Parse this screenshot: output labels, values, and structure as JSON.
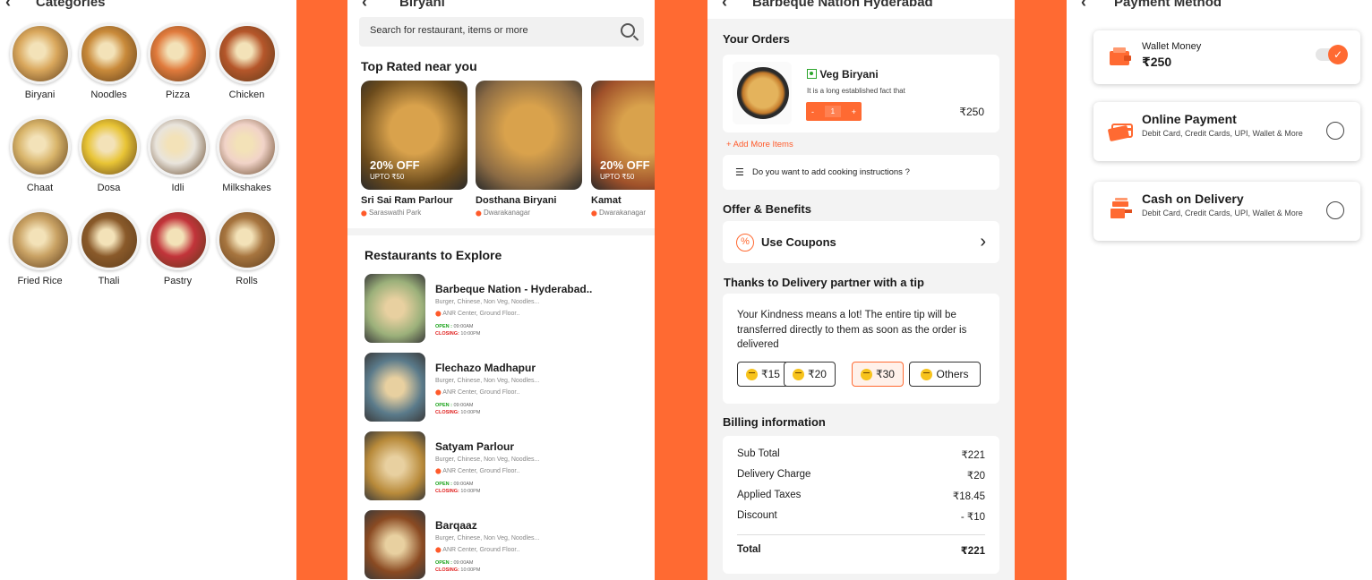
{
  "categories": {
    "title": "Categories",
    "items": [
      {
        "label": "Biryani",
        "color": "#d9a75c"
      },
      {
        "label": "Noodles",
        "color": "#c98a3a"
      },
      {
        "label": "Pizza",
        "color": "#e07a3c"
      },
      {
        "label": "Chicken",
        "color": "#b5562a"
      },
      {
        "label": "Chaat",
        "color": "#d8b46a"
      },
      {
        "label": "Dosa",
        "color": "#e8c435"
      },
      {
        "label": "Idli",
        "color": "#e9e4dc"
      },
      {
        "label": "Milkshakes",
        "color": "#f1d3c8"
      },
      {
        "label": "Fried Rice",
        "color": "#c9a264"
      },
      {
        "label": "Thali",
        "color": "#8a5a2a"
      },
      {
        "label": "Pastry",
        "color": "#c2343a"
      },
      {
        "label": "Rolls",
        "color": "#a7753f"
      }
    ]
  },
  "biryani": {
    "title": "Biryani",
    "search_placeholder": "Search for restaurant, items or more",
    "top_rated_title": "Top Rated near you",
    "top_rated": [
      {
        "offer": "20% OFF",
        "upto": "UPTO ₹50",
        "name": "Sri Sai Ram Parlour",
        "location": "Saraswathi Park",
        "color": "#6a4a1c"
      },
      {
        "offer": "",
        "upto": "",
        "name": "Dosthana Biryani",
        "location": "Dwarakanagar",
        "color": "#8a6a44"
      },
      {
        "offer": "20% OFF",
        "upto": "UPTO ₹50",
        "name": "Kamat",
        "location": "Dwarakanagar",
        "color": "#a0512a"
      }
    ],
    "explore_title": "Restaurants to Explore",
    "restaurants": [
      {
        "name": "Barbeque Nation - Hyderabad..",
        "tags": "Burger, Chinese, Non Veg, Noodles...",
        "address": "ANR Center, Ground Floor..",
        "open": "OPEN :",
        "open_time": "09:00AM",
        "close": "CLOSING:",
        "close_time": "10:00PM",
        "color": "#9bb07a"
      },
      {
        "name": "Flechazo Madhapur",
        "tags": "Burger, Chinese, Non Veg, Noodles...",
        "address": "ANR Center, Ground Floor..",
        "open": "OPEN :",
        "open_time": "09:00AM",
        "close": "CLOSING:",
        "close_time": "10:00PM",
        "color": "#5a7a8a"
      },
      {
        "name": "Satyam Parlour",
        "tags": "Burger, Chinese, Non Veg, Noodles...",
        "address": "ANR Center, Ground Floor..",
        "open": "OPEN :",
        "open_time": "09:00AM",
        "close": "CLOSING:",
        "close_time": "10:00PM",
        "color": "#b88a3a"
      },
      {
        "name": "Barqaaz",
        "tags": "Burger, Chinese, Non Veg, Noodles...",
        "address": "ANR Center, Ground Floor..",
        "open": "OPEN :",
        "open_time": "09:00AM",
        "close": "CLOSING:",
        "close_time": "10:00PM",
        "color": "#8a4a22"
      }
    ]
  },
  "cart": {
    "title": "Barbeque Nation Hyderabad",
    "your_orders": "Your Orders",
    "item_name": "Veg Biryani",
    "item_desc": "It is a long established fact that",
    "item_price": "₹250",
    "qty_minus": "-",
    "qty_value": "1",
    "qty_plus": "+",
    "add_more": "+ Add More Items",
    "cooking_instructions": "Do you want to add cooking instructions ?",
    "offers_title": "Offer & Benefits",
    "use_coupons": "Use Coupons",
    "tip_title": "Thanks to Delivery partner with a tip",
    "tip_message": "Your Kindness means a lot! The entire tip will be transferred directly to them as soon as the order is delivered",
    "tips": [
      {
        "label": "₹15"
      },
      {
        "label": "₹20"
      },
      {
        "label": "₹30"
      },
      {
        "label": "Others"
      }
    ],
    "billing_title": "Billing information",
    "billing": [
      {
        "label": "Sub Total",
        "value": "₹221"
      },
      {
        "label": "Delivery Charge",
        "value": "₹20"
      },
      {
        "label": "Applied Taxes",
        "value": "₹18.45"
      },
      {
        "label": "Discount",
        "value": "- ₹10"
      }
    ],
    "total_label": "Total",
    "total_value": "₹221"
  },
  "payment": {
    "title": "Payment Method",
    "wallet_label": "Wallet Money",
    "wallet_amount": "₹250",
    "online_title": "Online Payment",
    "online_sub": "Debit Card, Credit Cards, UPI, Wallet & More",
    "cod_title": "Cash on Delivery",
    "cod_sub": "Debit Card, Credit Cards, UPI, Wallet & More",
    "accent": "#ff6a32"
  }
}
